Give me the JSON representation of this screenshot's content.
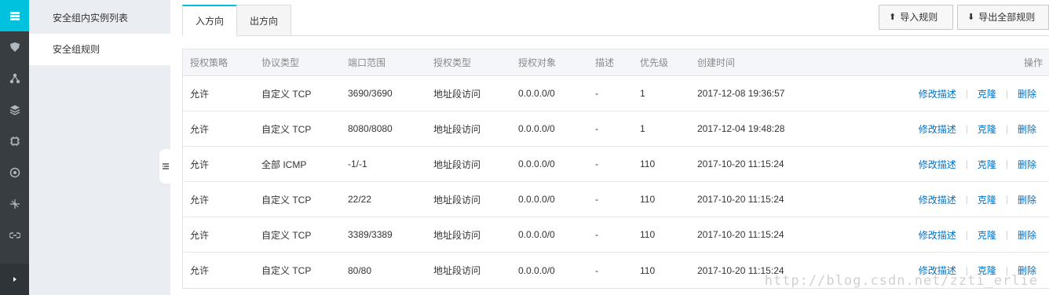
{
  "rail": {
    "icons": [
      "server-icon",
      "shield-icon",
      "network-icon",
      "layers-icon",
      "chip-icon",
      "eye-icon",
      "share-icon",
      "link-icon"
    ],
    "active_index": 0,
    "expand_icon": "chevron-right-icon"
  },
  "subnav": {
    "items": [
      {
        "label": "安全组内实例列表"
      },
      {
        "label": "安全组规则"
      }
    ],
    "active_index": 1
  },
  "tabs": [
    {
      "label": "入方向"
    },
    {
      "label": "出方向"
    }
  ],
  "toolbar": {
    "import_label": "导入规则",
    "export_label": "导出全部规则"
  },
  "table": {
    "headers": {
      "policy": "授权策略",
      "protocol": "协议类型",
      "port": "端口范围",
      "auth_type": "授权类型",
      "auth_object": "授权对象",
      "desc": "描述",
      "priority": "优先级",
      "created": "创建时间",
      "actions": "操作"
    },
    "action_labels": {
      "edit": "修改描述",
      "clone": "克隆",
      "delete": "删除"
    },
    "rows": [
      {
        "policy": "允许",
        "protocol": "自定义 TCP",
        "port": "3690/3690",
        "auth_type": "地址段访问",
        "auth_object": "0.0.0.0/0",
        "desc": "-",
        "priority": "1",
        "created": "2017-12-08 19:36:57"
      },
      {
        "policy": "允许",
        "protocol": "自定义 TCP",
        "port": "8080/8080",
        "auth_type": "地址段访问",
        "auth_object": "0.0.0.0/0",
        "desc": "-",
        "priority": "1",
        "created": "2017-12-04 19:48:28"
      },
      {
        "policy": "允许",
        "protocol": "全部 ICMP",
        "port": "-1/-1",
        "auth_type": "地址段访问",
        "auth_object": "0.0.0.0/0",
        "desc": "-",
        "priority": "110",
        "created": "2017-10-20 11:15:24"
      },
      {
        "policy": "允许",
        "protocol": "自定义 TCP",
        "port": "22/22",
        "auth_type": "地址段访问",
        "auth_object": "0.0.0.0/0",
        "desc": "-",
        "priority": "110",
        "created": "2017-10-20 11:15:24"
      },
      {
        "policy": "允许",
        "protocol": "自定义 TCP",
        "port": "3389/3389",
        "auth_type": "地址段访问",
        "auth_object": "0.0.0.0/0",
        "desc": "-",
        "priority": "110",
        "created": "2017-10-20 11:15:24"
      },
      {
        "policy": "允许",
        "protocol": "自定义 TCP",
        "port": "80/80",
        "auth_type": "地址段访问",
        "auth_object": "0.0.0.0/0",
        "desc": "-",
        "priority": "110",
        "created": "2017-10-20 11:15:24"
      }
    ]
  },
  "watermark": "http://blog.csdn.net/zzti_erlie",
  "colors": {
    "accent": "#00c1de",
    "link": "#0072c6",
    "rail_bg": "#373d41",
    "subnav_bg": "#eaedf1"
  }
}
